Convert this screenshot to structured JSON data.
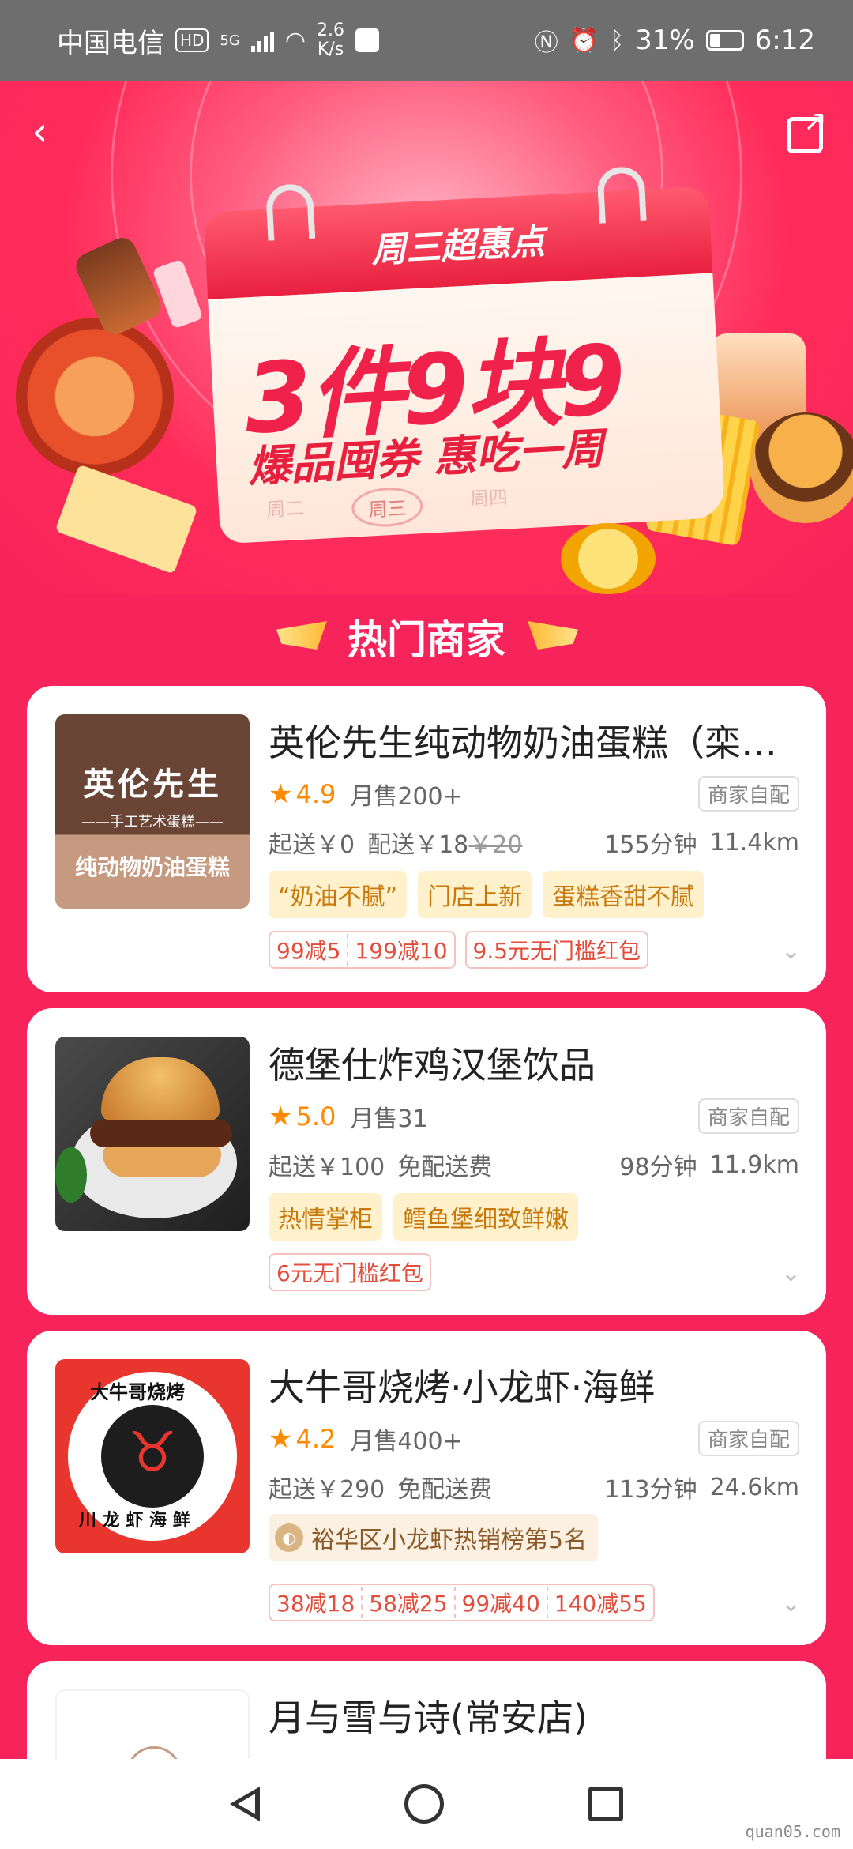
{
  "status_bar": {
    "carrier": "中国电信",
    "hd": "HD",
    "network": "5G",
    "speed": "2.6",
    "speed_unit": "K/s",
    "battery": "31%",
    "time": "6:12"
  },
  "banner": {
    "badge": "周三超惠点",
    "headline": "3件9块9",
    "subline": "爆品囤券 惠吃一周",
    "days": [
      "周二",
      "周三",
      "周四"
    ]
  },
  "section_title": "热门商家",
  "stores": [
    {
      "name": "英伦先生纯动物奶油蛋糕（栾…",
      "logo_lines": [
        "英伦先生",
        "——手工艺术蛋糕——",
        "纯动物奶油蛋糕"
      ],
      "rating": "4.9",
      "monthly_sales": "月售200+",
      "delivery_type": "商家自配",
      "min_order": "起送￥0",
      "delivery_fee": "配送￥18",
      "delivery_fee_original": "￥20",
      "time": "155分钟",
      "distance": "11.4km",
      "tags": [
        "“奶油不腻”",
        "门店上新",
        "蛋糕香甜不腻"
      ],
      "promos": [
        [
          "99减5",
          "199减10"
        ],
        [
          "9.5元无门槛红包"
        ]
      ]
    },
    {
      "name": "德堡仕炸鸡汉堡饮品",
      "rating": "5.0",
      "monthly_sales": "月售31",
      "delivery_type": "商家自配",
      "min_order": "起送￥100",
      "delivery_fee": "免配送费",
      "time": "98分钟",
      "distance": "11.9km",
      "tags": [
        "热情掌柜",
        "鳕鱼堡细致鲜嫩"
      ],
      "promos": [
        [
          "6元无门槛红包"
        ]
      ]
    },
    {
      "name": "大牛哥烧烤·小龙虾·海鲜",
      "logo_lines": [
        "大牛哥烧烤",
        "川 龙 虾 海 鲜"
      ],
      "rating": "4.2",
      "monthly_sales": "月售400+",
      "delivery_type": "商家自配",
      "min_order": "起送￥290",
      "delivery_fee": "免配送费",
      "time": "113分钟",
      "distance": "24.6km",
      "rank": "裕华区小龙虾热销榜第5名",
      "promos": [
        [
          "38减18",
          "58减25",
          "99减40",
          "140减55"
        ]
      ]
    },
    {
      "name": "月与雪与诗(常安店)"
    }
  ],
  "watermark": "quan05.com"
}
